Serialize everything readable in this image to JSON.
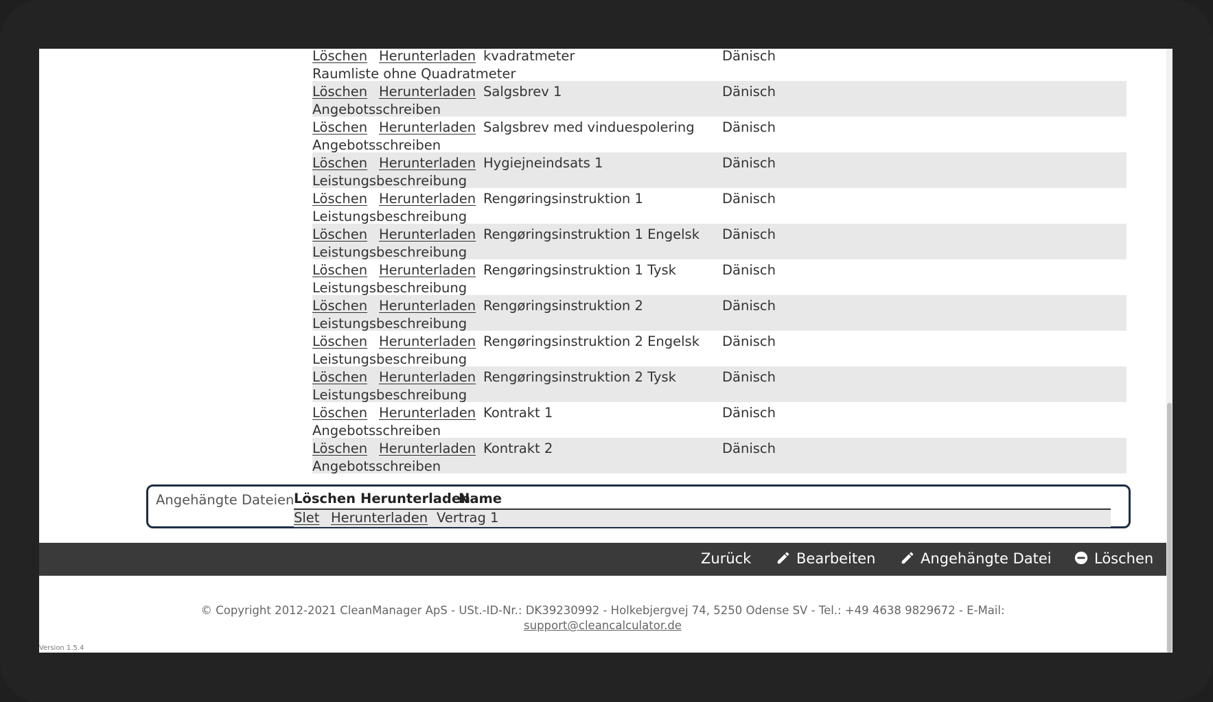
{
  "documents": {
    "delete_label": "Löschen",
    "download_label": "Herunterladen",
    "rows": [
      {
        "name": "kvadratmeter",
        "language": "Dänisch",
        "type": "Raumliste ohne Quadratmeter"
      },
      {
        "name": "Salgsbrev 1",
        "language": "Dänisch",
        "type": "Angebotsschreiben"
      },
      {
        "name": "Salgsbrev med vinduespolering",
        "language": "Dänisch",
        "type": "Angebotsschreiben"
      },
      {
        "name": "Hygiejneindsats 1",
        "language": "Dänisch",
        "type": "Leistungsbeschreibung"
      },
      {
        "name": "Rengøringsinstruktion 1",
        "language": "Dänisch",
        "type": "Leistungsbeschreibung"
      },
      {
        "name": "Rengøringsinstruktion 1 Engelsk",
        "language": "Dänisch",
        "type": "Leistungsbeschreibung"
      },
      {
        "name": "Rengøringsinstruktion 1 Tysk",
        "language": "Dänisch",
        "type": "Leistungsbeschreibung"
      },
      {
        "name": "Rengøringsinstruktion 2",
        "language": "Dänisch",
        "type": "Leistungsbeschreibung"
      },
      {
        "name": "Rengøringsinstruktion 2 Engelsk",
        "language": "Dänisch",
        "type": "Leistungsbeschreibung"
      },
      {
        "name": "Rengøringsinstruktion 2 Tysk",
        "language": "Dänisch",
        "type": "Leistungsbeschreibung"
      },
      {
        "name": "Kontrakt 1",
        "language": "Dänisch",
        "type": "Angebotsschreiben"
      },
      {
        "name": "Kontrakt 2",
        "language": "Dänisch",
        "type": "Angebotsschreiben"
      }
    ]
  },
  "attachments": {
    "label": "Angehängte Dateien",
    "headers": {
      "delete": "Löschen",
      "download": "Herunterladen",
      "name": "Name"
    },
    "rows": [
      {
        "delete": "Slet",
        "download": "Herunterladen",
        "name": "Vertrag 1"
      }
    ]
  },
  "actions": {
    "back": "Zurück",
    "edit": "Bearbeiten",
    "attach": "Angehängte Datei",
    "delete": "Löschen",
    "icons": [
      "pencil-icon",
      "pencil-icon",
      "minus-circle-icon"
    ]
  },
  "footer": {
    "copyright": "© Copyright 2012-2021 CleanManager ApS - USt.-ID-Nr.: DK39230992 - Holkebjergvej 74, 5250 Odense SV - Tel.: +49 4638 9829672 - E-Mail:",
    "email": "support@cleancalculator.de",
    "version": "Version 1.5.4"
  },
  "colors": {
    "action_bar": "#3a3a3a",
    "row_shade": "#e8e8e8",
    "focus_border": "#1d2d44"
  }
}
